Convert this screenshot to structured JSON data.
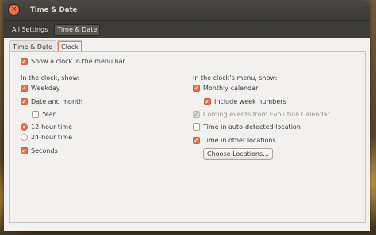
{
  "window": {
    "title": "Time & Date"
  },
  "toolbar": {
    "all_settings": "All Settings",
    "current": "Time & Date"
  },
  "tabs": [
    {
      "label": "Time & Date"
    },
    {
      "label": "Clock"
    }
  ],
  "clock": {
    "show_clock": "Show a clock in the menu bar",
    "left_title": "In the clock, show:",
    "weekday": "Weekday",
    "date_month": "Date and month",
    "year": "Year",
    "h12": "12-hour time",
    "h24": "24-hour time",
    "seconds": "Seconds",
    "right_title": "In the clock’s menu, show:",
    "monthly_calendar": "Monthly calendar",
    "week_numbers": "Include week numbers",
    "coming_events": "Coming events from Evolution Calendar",
    "auto_location": "Time in auto-detected location",
    "other_locations": "Time in other locations",
    "choose_locations": "Choose Locations…"
  },
  "colors": {
    "accent": "#df7552",
    "titlebar": "#3c3b37"
  }
}
